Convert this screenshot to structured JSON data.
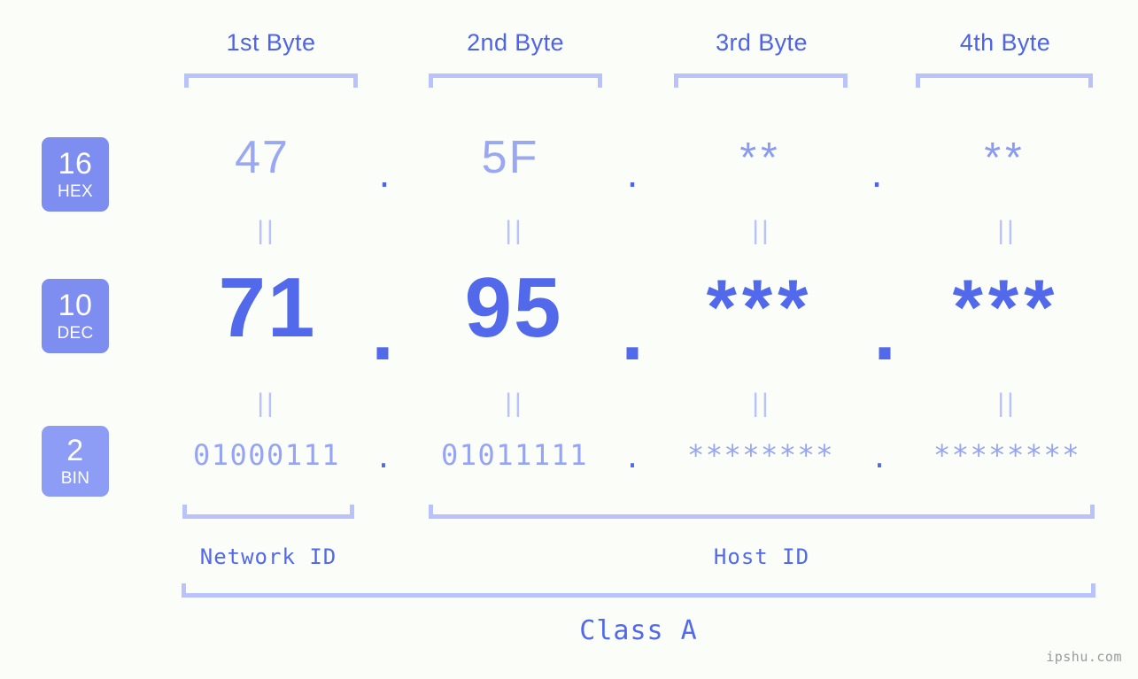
{
  "page": {
    "background_color": "#fbfdf8",
    "accent_color": "#5169ea",
    "light_accent_color": "#b9c2fb",
    "badge_color": "#7d8ef0",
    "watermark": "ipshu.com"
  },
  "byte_headers": [
    {
      "label": "1st Byte"
    },
    {
      "label": "2nd Byte"
    },
    {
      "label": "3rd Byte"
    },
    {
      "label": "4th Byte"
    }
  ],
  "bases": [
    {
      "number": "16",
      "name": "HEX"
    },
    {
      "number": "10",
      "name": "DEC"
    },
    {
      "number": "2",
      "name": "BIN"
    }
  ],
  "rows": {
    "hex": {
      "values": [
        "47",
        "5F",
        "**",
        "**"
      ],
      "separators": [
        ".",
        ".",
        "."
      ]
    },
    "dec": {
      "values": [
        "71",
        "95",
        "***",
        "***"
      ],
      "separators": [
        ".",
        ".",
        "."
      ]
    },
    "bin": {
      "values": [
        "01000111",
        "01011111",
        "********",
        "********"
      ],
      "separators": [
        ".",
        ".",
        "."
      ]
    }
  },
  "equality_marks": {
    "symbol": "||",
    "count_per_gap": 4
  },
  "segments": {
    "network_id": "Network ID",
    "host_id": "Host ID",
    "class": "Class A"
  }
}
